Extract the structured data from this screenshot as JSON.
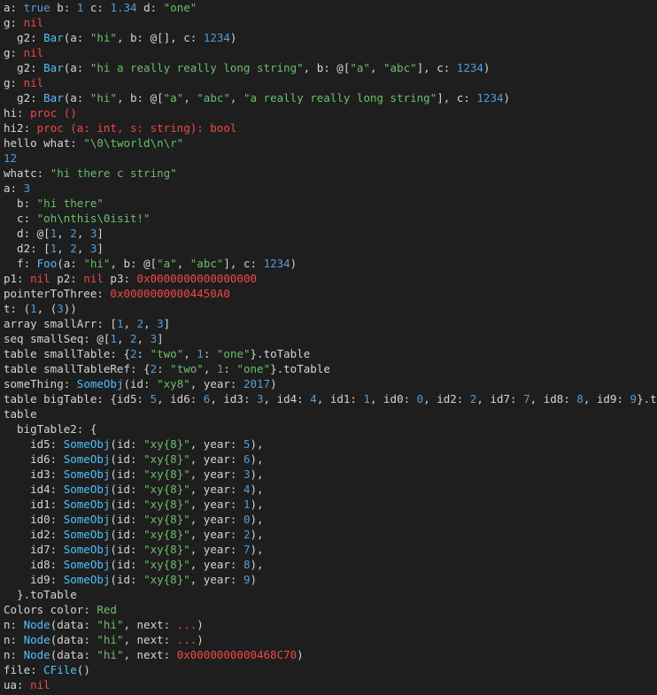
{
  "colors": {
    "background": "#1e1e1e",
    "text": "#d4d4d4",
    "number_bool": "#569cd6",
    "string": "#6abf69",
    "nil_proc_ptr": "#f44747",
    "type_name": "#4fc1ff"
  },
  "lines": [
    [
      [
        "t",
        "a: "
      ],
      [
        "k",
        "true"
      ],
      [
        "t",
        " b: "
      ],
      [
        "k",
        "1"
      ],
      [
        "t",
        " c: "
      ],
      [
        "k",
        "1.34"
      ],
      [
        "t",
        " d: "
      ],
      [
        "s",
        "\"one\""
      ]
    ],
    [
      [
        "t",
        "g: "
      ],
      [
        "r",
        "nil"
      ]
    ],
    [
      [
        "t",
        "  g2: "
      ],
      [
        "y",
        "Bar"
      ],
      [
        "t",
        "(a: "
      ],
      [
        "s",
        "\"hi\""
      ],
      [
        "t",
        ", b: @[], c: "
      ],
      [
        "k",
        "1234"
      ],
      [
        "t",
        ")"
      ]
    ],
    [
      [
        "t",
        "g: "
      ],
      [
        "r",
        "nil"
      ]
    ],
    [
      [
        "t",
        "  g2: "
      ],
      [
        "y",
        "Bar"
      ],
      [
        "t",
        "(a: "
      ],
      [
        "s",
        "\"hi a really really long string\""
      ],
      [
        "t",
        ", b: @["
      ],
      [
        "s",
        "\"a\""
      ],
      [
        "t",
        ", "
      ],
      [
        "s",
        "\"abc\""
      ],
      [
        "t",
        "], c: "
      ],
      [
        "k",
        "1234"
      ],
      [
        "t",
        ")"
      ]
    ],
    [
      [
        "t",
        "g: "
      ],
      [
        "r",
        "nil"
      ]
    ],
    [
      [
        "t",
        "  g2: "
      ],
      [
        "y",
        "Bar"
      ],
      [
        "t",
        "(a: "
      ],
      [
        "s",
        "\"hi\""
      ],
      [
        "t",
        ", b: @["
      ],
      [
        "s",
        "\"a\""
      ],
      [
        "t",
        ", "
      ],
      [
        "s",
        "\"abc\""
      ],
      [
        "t",
        ", "
      ],
      [
        "s",
        "\"a really really long string\""
      ],
      [
        "t",
        "], c: "
      ],
      [
        "k",
        "1234"
      ],
      [
        "t",
        ")"
      ]
    ],
    [
      [
        "t",
        "hi: "
      ],
      [
        "r",
        "proc ()"
      ]
    ],
    [
      [
        "t",
        "hi2: "
      ],
      [
        "r",
        "proc (a: int, s: string): bool"
      ]
    ],
    [
      [
        "t",
        "hello what: "
      ],
      [
        "s",
        "\"\\0\\tworld\\n\\r\""
      ]
    ],
    [
      [
        "k",
        "12"
      ]
    ],
    [
      [
        "t",
        "whatc: "
      ],
      [
        "s",
        "\"hi there c string\""
      ]
    ],
    [
      [
        "t",
        "a: "
      ],
      [
        "k",
        "3"
      ]
    ],
    [
      [
        "t",
        "  b: "
      ],
      [
        "s",
        "\"hi there\""
      ]
    ],
    [
      [
        "t",
        "  c: "
      ],
      [
        "s",
        "\"oh\\nthis\\0isit!\""
      ]
    ],
    [
      [
        "t",
        "  d: @["
      ],
      [
        "k",
        "1"
      ],
      [
        "t",
        ", "
      ],
      [
        "k",
        "2"
      ],
      [
        "t",
        ", "
      ],
      [
        "k",
        "3"
      ],
      [
        "t",
        "]"
      ]
    ],
    [
      [
        "t",
        "  d2: ["
      ],
      [
        "k",
        "1"
      ],
      [
        "t",
        ", "
      ],
      [
        "k",
        "2"
      ],
      [
        "t",
        ", "
      ],
      [
        "k",
        "3"
      ],
      [
        "t",
        "]"
      ]
    ],
    [
      [
        "t",
        "  f: "
      ],
      [
        "y",
        "Foo"
      ],
      [
        "t",
        "(a: "
      ],
      [
        "s",
        "\"hi\""
      ],
      [
        "t",
        ", b: @["
      ],
      [
        "s",
        "\"a\""
      ],
      [
        "t",
        ", "
      ],
      [
        "s",
        "\"abc\""
      ],
      [
        "t",
        "], c: "
      ],
      [
        "k",
        "1234"
      ],
      [
        "t",
        ")"
      ]
    ],
    [
      [
        "t",
        "p1: "
      ],
      [
        "r",
        "nil"
      ],
      [
        "t",
        " p2: "
      ],
      [
        "r",
        "nil"
      ],
      [
        "t",
        " p3: "
      ],
      [
        "r",
        "0x0000000000000000"
      ]
    ],
    [
      [
        "t",
        "pointerToThree: "
      ],
      [
        "r",
        "0x00000000004450A0"
      ]
    ],
    [
      [
        "t",
        "t: ("
      ],
      [
        "k",
        "1"
      ],
      [
        "t",
        ", ("
      ],
      [
        "k",
        "3"
      ],
      [
        "t",
        "))"
      ]
    ],
    [
      [
        "t",
        "array smallArr: ["
      ],
      [
        "k",
        "1"
      ],
      [
        "t",
        ", "
      ],
      [
        "k",
        "2"
      ],
      [
        "t",
        ", "
      ],
      [
        "k",
        "3"
      ],
      [
        "t",
        "]"
      ]
    ],
    [
      [
        "t",
        "seq smallSeq: @["
      ],
      [
        "k",
        "1"
      ],
      [
        "t",
        ", "
      ],
      [
        "k",
        "2"
      ],
      [
        "t",
        ", "
      ],
      [
        "k",
        "3"
      ],
      [
        "t",
        "]"
      ]
    ],
    [
      [
        "t",
        "table smallTable: {"
      ],
      [
        "k",
        "2"
      ],
      [
        "t",
        ": "
      ],
      [
        "s",
        "\"two\""
      ],
      [
        "t",
        ", "
      ],
      [
        "k",
        "1"
      ],
      [
        "t",
        ": "
      ],
      [
        "s",
        "\"one\""
      ],
      [
        "t",
        "}.toTable"
      ]
    ],
    [
      [
        "t",
        "table smallTableRef: {"
      ],
      [
        "k",
        "2"
      ],
      [
        "t",
        ": "
      ],
      [
        "s",
        "\"two\""
      ],
      [
        "t",
        ", "
      ],
      [
        "k",
        "1"
      ],
      [
        "t",
        ": "
      ],
      [
        "s",
        "\"one\""
      ],
      [
        "t",
        "}.toTable"
      ]
    ],
    [
      [
        "t",
        "someThing: "
      ],
      [
        "y",
        "SomeObj"
      ],
      [
        "t",
        "(id: "
      ],
      [
        "s",
        "\"xy8\""
      ],
      [
        "t",
        ", year: "
      ],
      [
        "k",
        "2017"
      ],
      [
        "t",
        ")"
      ]
    ],
    [
      [
        "t",
        "table bigTable: {id5: "
      ],
      [
        "k",
        "5"
      ],
      [
        "t",
        ", id6: "
      ],
      [
        "k",
        "6"
      ],
      [
        "t",
        ", id3: "
      ],
      [
        "k",
        "3"
      ],
      [
        "t",
        ", id4: "
      ],
      [
        "k",
        "4"
      ],
      [
        "t",
        ", id1: "
      ],
      [
        "k",
        "1"
      ],
      [
        "t",
        ", id0: "
      ],
      [
        "k",
        "0"
      ],
      [
        "t",
        ", id2: "
      ],
      [
        "k",
        "2"
      ],
      [
        "t",
        ", id7: "
      ],
      [
        "k",
        "7"
      ],
      [
        "t",
        ", id8: "
      ],
      [
        "k",
        "8"
      ],
      [
        "t",
        ", id9: "
      ],
      [
        "k",
        "9"
      ],
      [
        "t",
        "}.toTable"
      ]
    ],
    [
      [
        "t",
        "table"
      ]
    ],
    [
      [
        "t",
        "  bigTable2: {"
      ]
    ],
    [
      [
        "t",
        "    id5: "
      ],
      [
        "y",
        "SomeObj"
      ],
      [
        "t",
        "(id: "
      ],
      [
        "s",
        "\"xy{8}\""
      ],
      [
        "t",
        ", year: "
      ],
      [
        "k",
        "5"
      ],
      [
        "t",
        "),"
      ]
    ],
    [
      [
        "t",
        "    id6: "
      ],
      [
        "y",
        "SomeObj"
      ],
      [
        "t",
        "(id: "
      ],
      [
        "s",
        "\"xy{8}\""
      ],
      [
        "t",
        ", year: "
      ],
      [
        "k",
        "6"
      ],
      [
        "t",
        "),"
      ]
    ],
    [
      [
        "t",
        "    id3: "
      ],
      [
        "y",
        "SomeObj"
      ],
      [
        "t",
        "(id: "
      ],
      [
        "s",
        "\"xy{8}\""
      ],
      [
        "t",
        ", year: "
      ],
      [
        "k",
        "3"
      ],
      [
        "t",
        "),"
      ]
    ],
    [
      [
        "t",
        "    id4: "
      ],
      [
        "y",
        "SomeObj"
      ],
      [
        "t",
        "(id: "
      ],
      [
        "s",
        "\"xy{8}\""
      ],
      [
        "t",
        ", year: "
      ],
      [
        "k",
        "4"
      ],
      [
        "t",
        "),"
      ]
    ],
    [
      [
        "t",
        "    id1: "
      ],
      [
        "y",
        "SomeObj"
      ],
      [
        "t",
        "(id: "
      ],
      [
        "s",
        "\"xy{8}\""
      ],
      [
        "t",
        ", year: "
      ],
      [
        "k",
        "1"
      ],
      [
        "t",
        "),"
      ]
    ],
    [
      [
        "t",
        "    id0: "
      ],
      [
        "y",
        "SomeObj"
      ],
      [
        "t",
        "(id: "
      ],
      [
        "s",
        "\"xy{8}\""
      ],
      [
        "t",
        ", year: "
      ],
      [
        "k",
        "0"
      ],
      [
        "t",
        "),"
      ]
    ],
    [
      [
        "t",
        "    id2: "
      ],
      [
        "y",
        "SomeObj"
      ],
      [
        "t",
        "(id: "
      ],
      [
        "s",
        "\"xy{8}\""
      ],
      [
        "t",
        ", year: "
      ],
      [
        "k",
        "2"
      ],
      [
        "t",
        "),"
      ]
    ],
    [
      [
        "t",
        "    id7: "
      ],
      [
        "y",
        "SomeObj"
      ],
      [
        "t",
        "(id: "
      ],
      [
        "s",
        "\"xy{8}\""
      ],
      [
        "t",
        ", year: "
      ],
      [
        "k",
        "7"
      ],
      [
        "t",
        "),"
      ]
    ],
    [
      [
        "t",
        "    id8: "
      ],
      [
        "y",
        "SomeObj"
      ],
      [
        "t",
        "(id: "
      ],
      [
        "s",
        "\"xy{8}\""
      ],
      [
        "t",
        ", year: "
      ],
      [
        "k",
        "8"
      ],
      [
        "t",
        "),"
      ]
    ],
    [
      [
        "t",
        "    id9: "
      ],
      [
        "y",
        "SomeObj"
      ],
      [
        "t",
        "(id: "
      ],
      [
        "s",
        "\"xy{8}\""
      ],
      [
        "t",
        ", year: "
      ],
      [
        "k",
        "9"
      ],
      [
        "t",
        ")"
      ]
    ],
    [
      [
        "t",
        "  }.toTable"
      ]
    ],
    [
      [
        "t",
        "Colors color: "
      ],
      [
        "s",
        "Red"
      ]
    ],
    [
      [
        "t",
        "n: "
      ],
      [
        "y",
        "Node"
      ],
      [
        "t",
        "(data: "
      ],
      [
        "s",
        "\"hi\""
      ],
      [
        "t",
        ", next: "
      ],
      [
        "r",
        "..."
      ],
      [
        "t",
        ")"
      ]
    ],
    [
      [
        "t",
        "n: "
      ],
      [
        "y",
        "Node"
      ],
      [
        "t",
        "(data: "
      ],
      [
        "s",
        "\"hi\""
      ],
      [
        "t",
        ", next: "
      ],
      [
        "r",
        "..."
      ],
      [
        "t",
        ")"
      ]
    ],
    [
      [
        "t",
        "n: "
      ],
      [
        "y",
        "Node"
      ],
      [
        "t",
        "(data: "
      ],
      [
        "s",
        "\"hi\""
      ],
      [
        "t",
        ", next: "
      ],
      [
        "r",
        "0x0000000000468C70"
      ],
      [
        "t",
        ")"
      ]
    ],
    [
      [
        "t",
        "file: "
      ],
      [
        "y",
        "CFile"
      ],
      [
        "t",
        "()"
      ]
    ],
    [
      [
        "t",
        "ua: "
      ],
      [
        "r",
        "nil"
      ]
    ]
  ]
}
